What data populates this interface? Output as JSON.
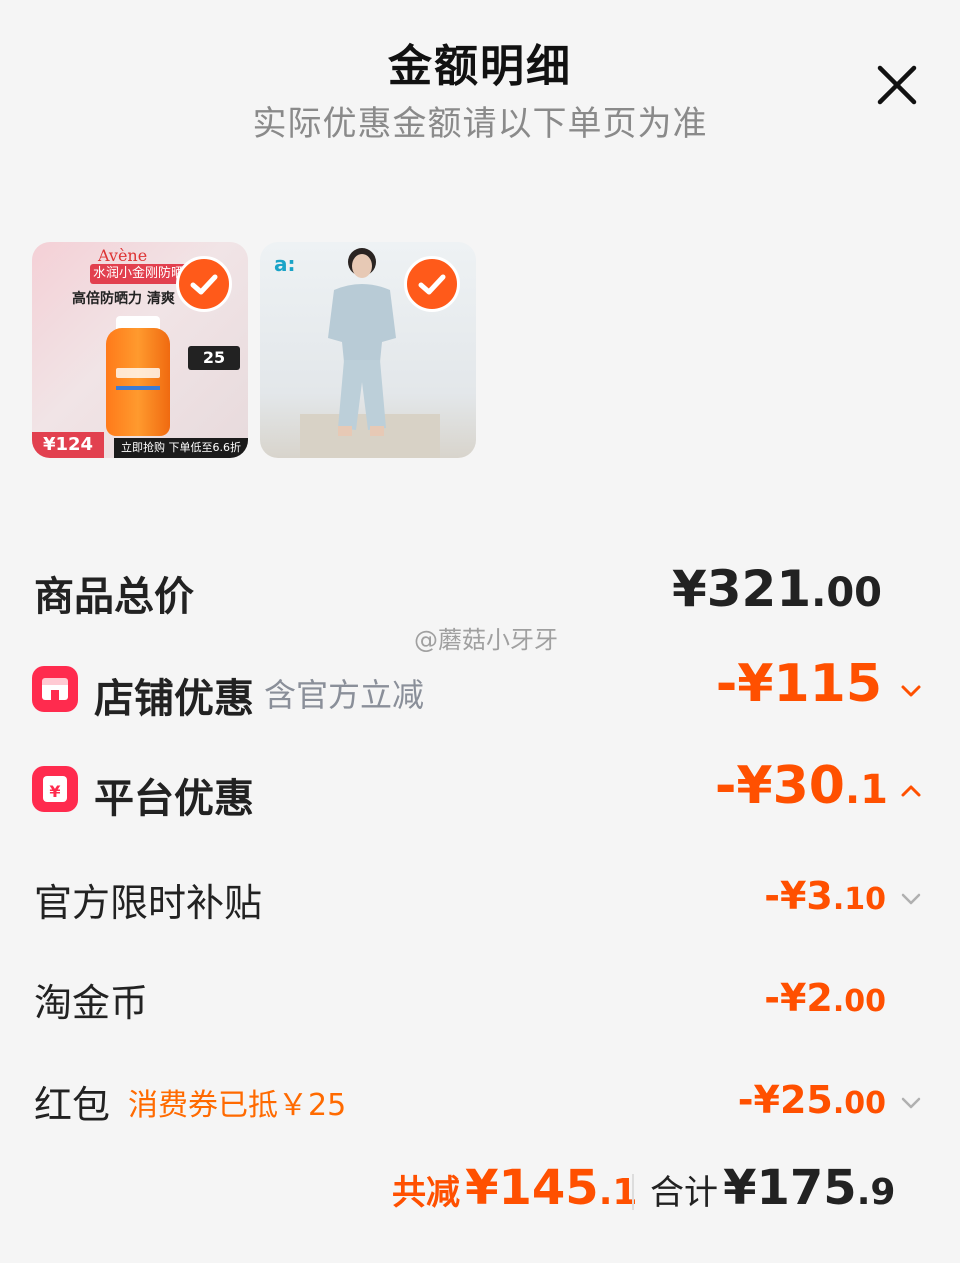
{
  "header": {
    "title": "金额明细",
    "subtitle": "实际优惠金额请以下单页为准"
  },
  "products": [
    {
      "brand_text": "Avène",
      "banner": "水润小金刚防晒乳",
      "slogan": "高倍防晒力 清爽",
      "side_badge": "25",
      "price_tag": "¥124",
      "footer_text": "立即抢购 下单低至6.6折"
    },
    {
      "brand_text": "a:"
    }
  ],
  "summary": {
    "goods_total_label": "商品总价",
    "goods_total_int": "¥321",
    "goods_total_dec": ".00",
    "store_discount_label": "店铺优惠",
    "store_discount_note": "含官方立减",
    "store_discount_value": "-¥115",
    "platform_discount_label": "平台优惠",
    "platform_discount_value": "-¥30",
    "platform_discount_dec": ".1",
    "items": [
      {
        "label": "官方限时补贴",
        "value": "-¥3",
        "dec": ".10",
        "note": ""
      },
      {
        "label": "淘金币",
        "value": "-¥2",
        "dec": ".00",
        "note": ""
      },
      {
        "label": "红包",
        "value": "-¥25",
        "dec": ".00",
        "note": "消费券已抵￥25"
      }
    ]
  },
  "footer": {
    "total_discount_label": "共减",
    "total_discount_int": "¥145",
    "total_discount_dec": ".1",
    "total_label": "合计",
    "total_int": "¥175",
    "total_dec": ".9"
  },
  "watermark": "@蘑菇小牙牙",
  "colors": {
    "accent": "#ff5000",
    "badge": "#ff2b4e",
    "check": "#ff5a1a"
  },
  "icons": [
    "close-icon",
    "check-icon",
    "store-icon",
    "platform-icon",
    "chevron-down-icon",
    "chevron-up-icon"
  ]
}
